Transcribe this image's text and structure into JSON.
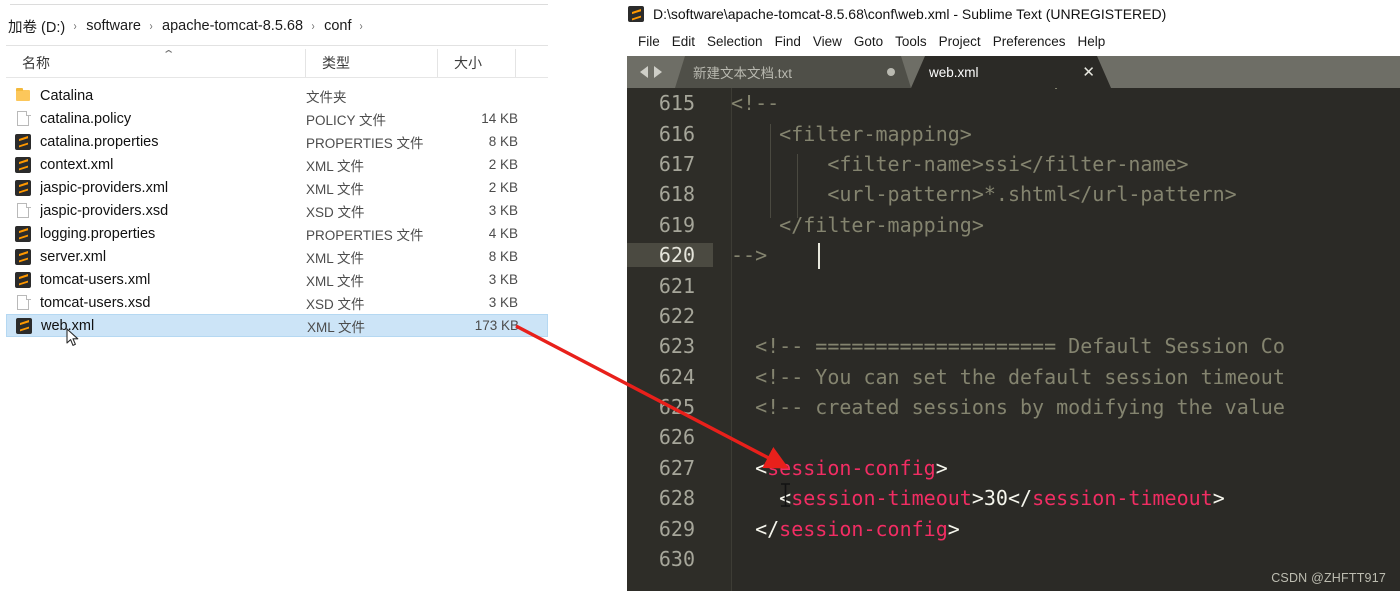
{
  "explorer": {
    "breadcrumb": {
      "crumbs": [
        "加卷 (D:)",
        "software",
        "apache-tomcat-8.5.68",
        "conf"
      ],
      "separator": "›"
    },
    "columns": [
      {
        "key": "name",
        "label": "名称"
      },
      {
        "key": "type",
        "label": "类型"
      },
      {
        "key": "size",
        "label": "大小"
      },
      {
        "key": "blank",
        "label": ""
      }
    ],
    "sort_caret": "⌃",
    "files": [
      {
        "icon": "folder-icon",
        "name": "Catalina",
        "type": "文件夹",
        "size": ""
      },
      {
        "icon": "blank-doc-icon",
        "name": "catalina.policy",
        "type": "POLICY 文件",
        "size": "14 KB"
      },
      {
        "icon": "sublime-icon",
        "name": "catalina.properties",
        "type": "PROPERTIES 文件",
        "size": "8 KB"
      },
      {
        "icon": "sublime-icon",
        "name": "context.xml",
        "type": "XML 文件",
        "size": "2 KB"
      },
      {
        "icon": "sublime-icon",
        "name": "jaspic-providers.xml",
        "type": "XML 文件",
        "size": "2 KB"
      },
      {
        "icon": "blank-doc-icon",
        "name": "jaspic-providers.xsd",
        "type": "XSD 文件",
        "size": "3 KB"
      },
      {
        "icon": "sublime-icon",
        "name": "logging.properties",
        "type": "PROPERTIES 文件",
        "size": "4 KB"
      },
      {
        "icon": "sublime-icon",
        "name": "server.xml",
        "type": "XML 文件",
        "size": "8 KB"
      },
      {
        "icon": "sublime-icon",
        "name": "tomcat-users.xml",
        "type": "XML 文件",
        "size": "3 KB"
      },
      {
        "icon": "blank-doc-icon",
        "name": "tomcat-users.xsd",
        "type": "XSD 文件",
        "size": "3 KB"
      },
      {
        "icon": "sublime-icon",
        "name": "web.xml",
        "type": "XML 文件",
        "size": "173 KB",
        "selected": true
      }
    ]
  },
  "sublime": {
    "title": "D:\\software\\apache-tomcat-8.5.68\\conf\\web.xml - Sublime Text (UNREGISTERED)",
    "menu": [
      "File",
      "Edit",
      "Selection",
      "Find",
      "View",
      "Goto",
      "Tools",
      "Project",
      "Preferences",
      "Help"
    ],
    "tabs": [
      {
        "label": "新建文本文档.txt",
        "active": false,
        "modified": true,
        "close_glyph": ""
      },
      {
        "label": "web.xml",
        "active": true,
        "modified": false,
        "close_glyph": "✕"
      }
    ],
    "editor": {
      "partial_top_line": "                        <!--",
      "lines": [
        {
          "num": "615",
          "current": false,
          "parts": [
            {
              "t": "comment",
              "s": "<!--"
            }
          ]
        },
        {
          "num": "616",
          "current": false,
          "parts": [
            {
              "t": "comment",
              "s": "    <filter-mapping>"
            }
          ]
        },
        {
          "num": "617",
          "current": false,
          "parts": [
            {
              "t": "comment",
              "s": "        <filter-name>ssi</filter-name>"
            }
          ]
        },
        {
          "num": "618",
          "current": false,
          "parts": [
            {
              "t": "comment",
              "s": "        <url-pattern>*.shtml</url-pattern>"
            }
          ]
        },
        {
          "num": "619",
          "current": false,
          "parts": [
            {
              "t": "comment",
              "s": "    </filter-mapping>"
            }
          ]
        },
        {
          "num": "620",
          "current": true,
          "parts": [
            {
              "t": "comment",
              "s": "-->"
            }
          ]
        },
        {
          "num": "621",
          "current": false,
          "parts": []
        },
        {
          "num": "622",
          "current": false,
          "parts": []
        },
        {
          "num": "623",
          "current": false,
          "parts": [
            {
              "t": "comment",
              "s": "  <!-- ==================== Default Session Co"
            }
          ]
        },
        {
          "num": "624",
          "current": false,
          "parts": [
            {
              "t": "comment",
              "s": "  <!-- You can set the default session timeout"
            }
          ]
        },
        {
          "num": "625",
          "current": false,
          "parts": [
            {
              "t": "comment",
              "s": "  <!-- created sessions by modifying the value"
            }
          ]
        },
        {
          "num": "626",
          "current": false,
          "parts": []
        },
        {
          "num": "627",
          "current": false,
          "parts": [
            {
              "t": "punct",
              "s": "  <"
            },
            {
              "t": "tag",
              "s": "session-config"
            },
            {
              "t": "punct",
              "s": ">"
            }
          ]
        },
        {
          "num": "628",
          "current": false,
          "parts": [
            {
              "t": "punct",
              "s": "    <"
            },
            {
              "t": "tag",
              "s": "session-timeout"
            },
            {
              "t": "punct",
              "s": ">"
            },
            {
              "t": "text",
              "s": "30"
            },
            {
              "t": "punct",
              "s": "</"
            },
            {
              "t": "tag",
              "s": "session-timeout"
            },
            {
              "t": "punct",
              "s": ">"
            }
          ]
        },
        {
          "num": "629",
          "current": false,
          "parts": [
            {
              "t": "punct",
              "s": "  </"
            },
            {
              "t": "tag",
              "s": "session-config"
            },
            {
              "t": "punct",
              "s": ">"
            }
          ]
        },
        {
          "num": "630",
          "current": false,
          "parts": []
        }
      ]
    }
  },
  "watermark": "CSDN @ZHFTT917",
  "colors": {
    "editor_bg": "#2b2a26",
    "gutter_bg": "#2e2d28",
    "tabbar_bg": "#6e6e66",
    "tag_pink": "#f12d63",
    "comment_olive": "#84846f",
    "selection_blue": "#cce4f7",
    "arrow_red": "#e8201b"
  }
}
